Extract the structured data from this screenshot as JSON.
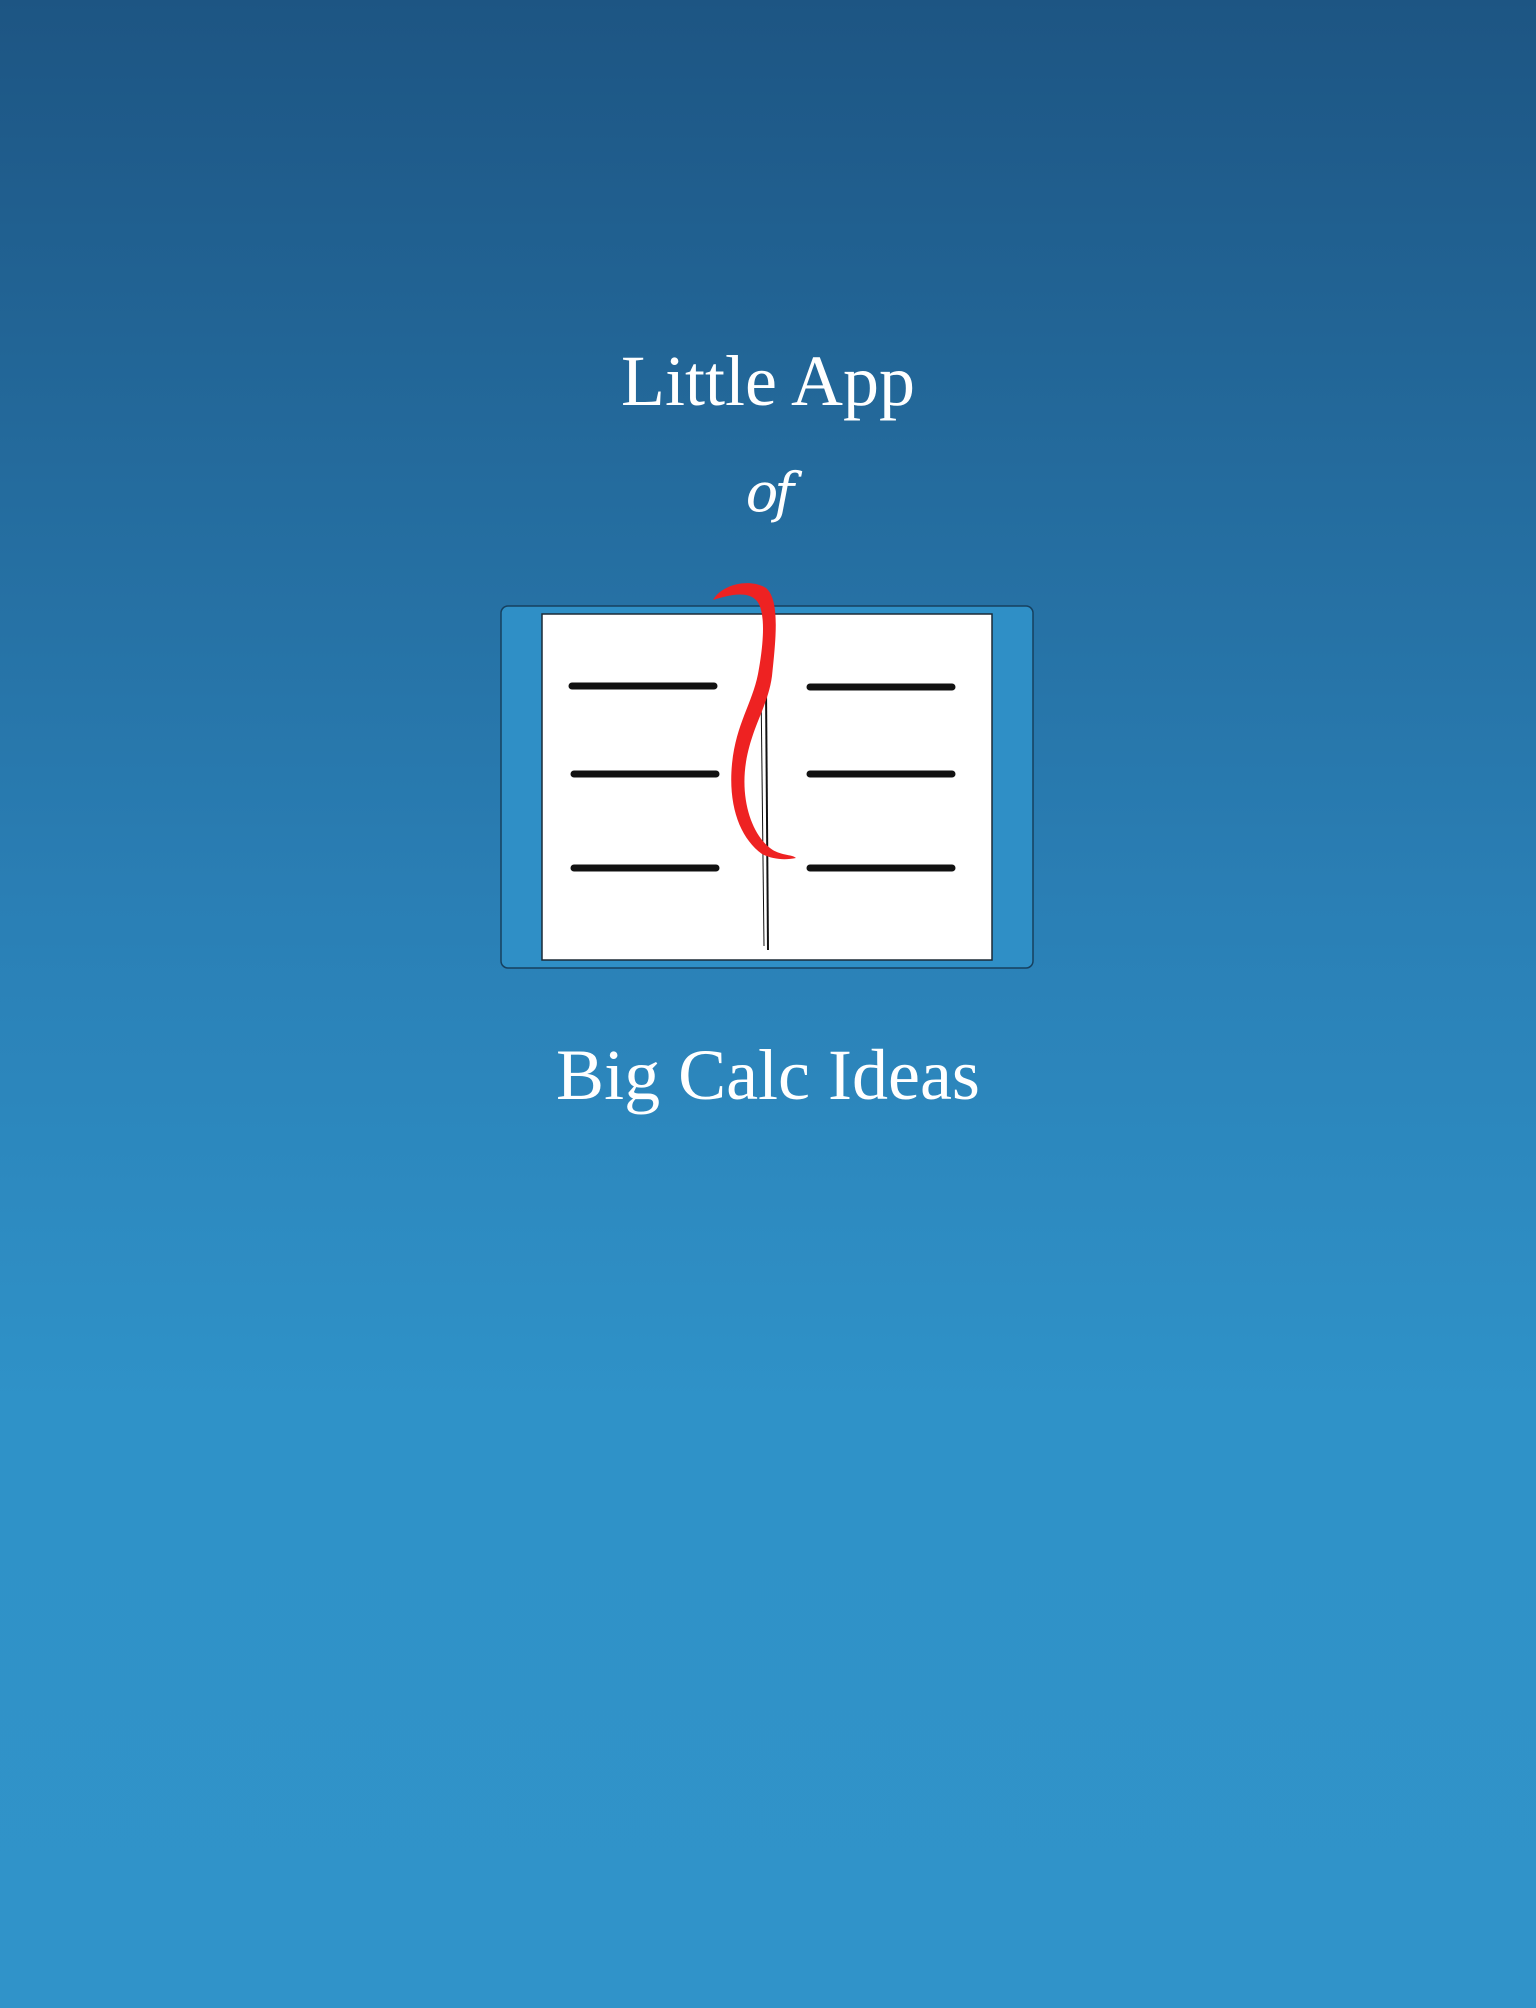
{
  "splash": {
    "title_line_1": "Little App",
    "title_connector": "of",
    "title_line_2": "Big Calc Ideas",
    "logo_icon": "open-book-with-bookmark-icon"
  },
  "colors": {
    "background_top": "#1d5583",
    "background_bottom": "#3093c9",
    "text": "#ffffff",
    "book_cover": "#2f8fc6",
    "book_page": "#ffffff",
    "book_lines": "#111111",
    "bookmark": "#ee2222"
  }
}
